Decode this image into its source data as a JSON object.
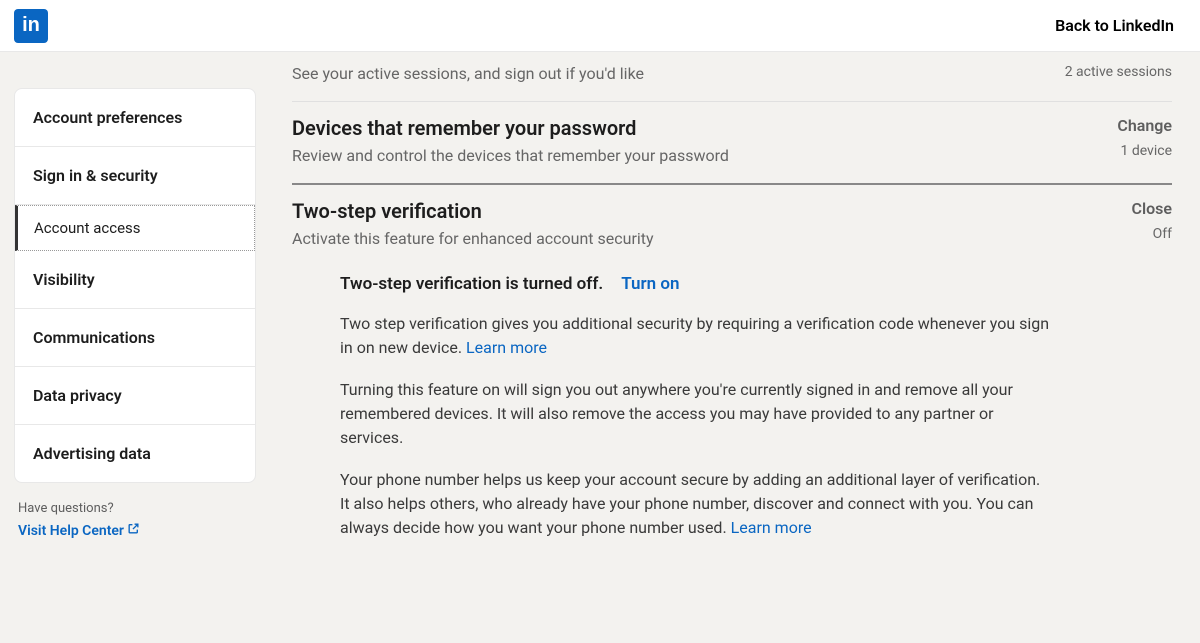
{
  "header": {
    "logo_text": "in",
    "back_label": "Back to LinkedIn"
  },
  "sidebar": {
    "items": [
      {
        "label": "Account preferences"
      },
      {
        "label": "Sign in & security"
      },
      {
        "label": "Account access"
      },
      {
        "label": "Visibility"
      },
      {
        "label": "Communications"
      },
      {
        "label": "Data privacy"
      },
      {
        "label": "Advertising data"
      }
    ]
  },
  "help": {
    "question": "Have questions?",
    "link_label": "Visit Help Center"
  },
  "settings": {
    "active_sessions": {
      "desc": "See your active sessions, and sign out if you'd like",
      "meta": "2 active sessions"
    },
    "devices": {
      "title": "Devices that remember your password",
      "desc": "Review and control the devices that remember your password",
      "action": "Change",
      "meta": "1 device"
    },
    "twostep": {
      "title": "Two-step verification",
      "desc": "Activate this feature for enhanced account security",
      "action": "Close",
      "meta": "Off",
      "status": "Two-step verification is turned off.",
      "turn_on": "Turn on",
      "p1_a": "Two step verification gives you additional security by requiring a verification code whenever you sign in on new device. ",
      "p2": "Turning this feature on will sign you out anywhere you're currently signed in and remove all your remembered devices. It will also remove the access you may have provided to any partner or services.",
      "p3_a": "Your phone number helps us keep your account secure by adding an additional layer of verification. It also helps others, who already have your phone number, discover and connect with you. You can always decide how you want your phone number used. ",
      "learn_more": "Learn more"
    }
  }
}
